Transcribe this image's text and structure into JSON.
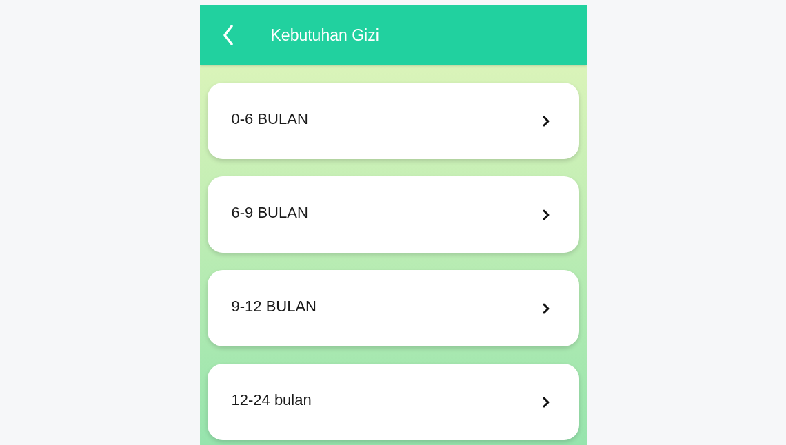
{
  "header": {
    "title": "Kebutuhan Gizi"
  },
  "items": [
    {
      "label": "0-6 BULAN"
    },
    {
      "label": "6-9 BULAN"
    },
    {
      "label": "9-12 BULAN"
    },
    {
      "label": "12-24 bulan"
    }
  ]
}
